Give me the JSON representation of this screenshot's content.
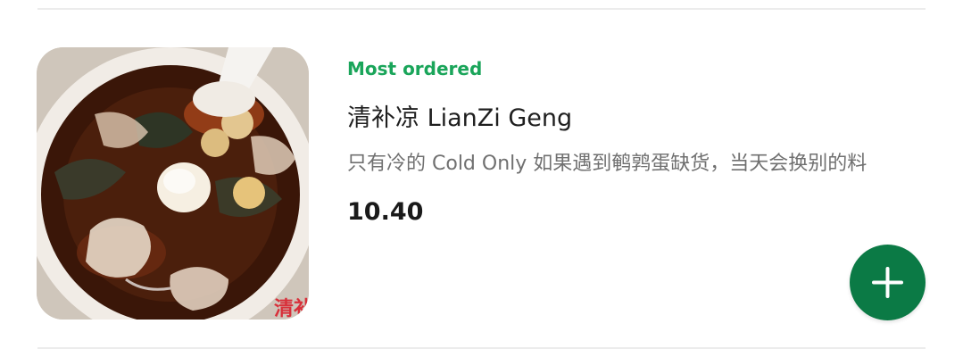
{
  "item": {
    "tag": "Most ordered",
    "name": "清补凉 LianZi Geng",
    "description": "只有冷的 Cold Only 如果遇到鹌鹑蛋缺货，当天会换别的料",
    "price": "10.40",
    "image_overlay_text": "清补",
    "image_icon": "dessert-bowl-photo"
  },
  "add_button": {
    "icon": "plus-icon"
  },
  "colors": {
    "tag": "#1aa55a",
    "accent": "#0b7a45",
    "name": "#1f1f1f",
    "description": "#707070",
    "divider": "#ececec"
  }
}
